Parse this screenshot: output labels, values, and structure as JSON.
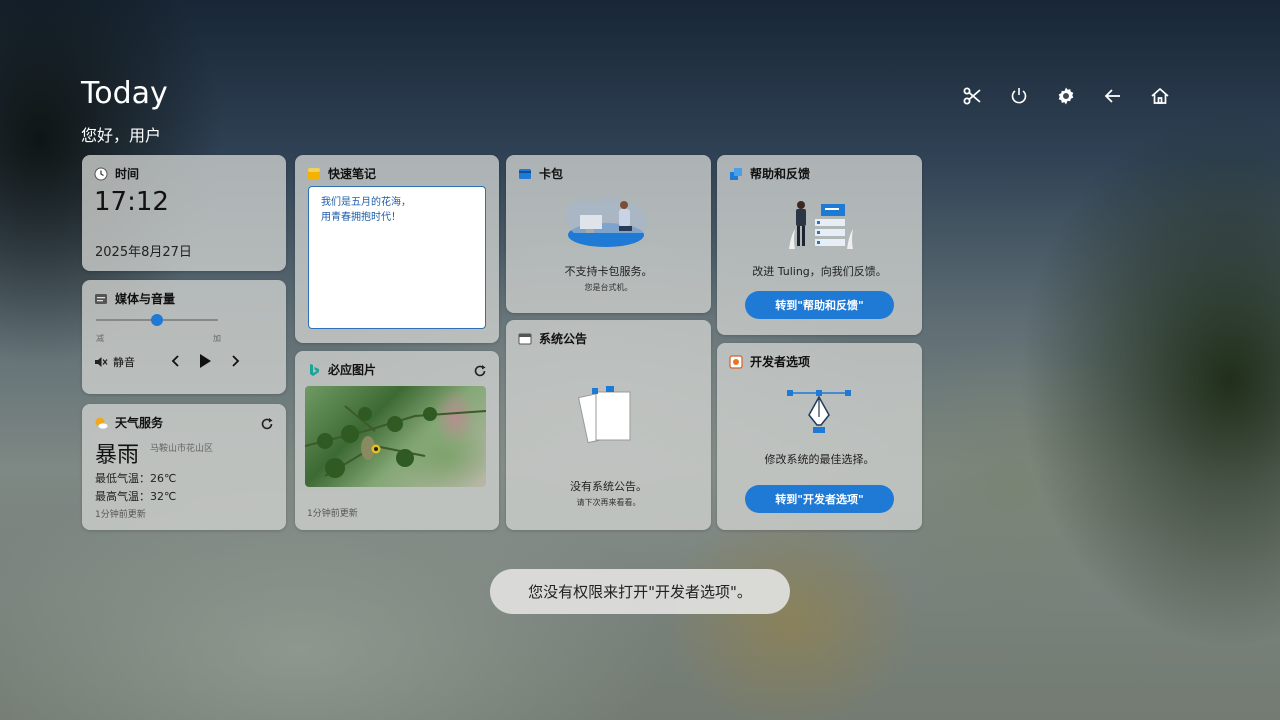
{
  "header": {
    "title": "Today",
    "greeting": "您好，用户"
  },
  "toolbar": [
    "scissors-icon",
    "power-icon",
    "gear-icon",
    "back-arrow-icon",
    "home-icon"
  ],
  "cards": {
    "time": {
      "title": "时间",
      "time": "17:12",
      "date": "2025年8月27日"
    },
    "media": {
      "title": "媒体与音量",
      "volume_percent": 50,
      "min_label": "减",
      "max_label": "加",
      "mute_label": "静音"
    },
    "weather": {
      "title": "天气服务",
      "condition": "暴雨",
      "location": "马鞍山市花山区",
      "min_temp": "最低气温：26℃",
      "max_temp": "最高气温：32℃",
      "updated": "1分钟前更新"
    },
    "notes": {
      "title": "快速笔记",
      "lines": [
        "我们是五月的花海，",
        "用青春拥抱时代！"
      ]
    },
    "bing": {
      "title": "必应图片",
      "updated": "1分钟前更新"
    },
    "wallet": {
      "title": "卡包",
      "message": "不支持卡包服务。",
      "sub": "您是台式机。"
    },
    "announce": {
      "title": "系统公告",
      "message": "没有系统公告。",
      "sub": "请下次再来看看。"
    },
    "help": {
      "title": "帮助和反馈",
      "message": "改进 Tuling，向我们反馈。",
      "button": "转到\"帮助和反馈\""
    },
    "dev": {
      "title": "开发者选项",
      "message": "修改系统的最佳选择。",
      "button": "转到\"开发者选项\""
    }
  },
  "toast": "您没有权限来打开\"开发者选项\"。",
  "colors": {
    "accent": "#1f7ad6"
  }
}
